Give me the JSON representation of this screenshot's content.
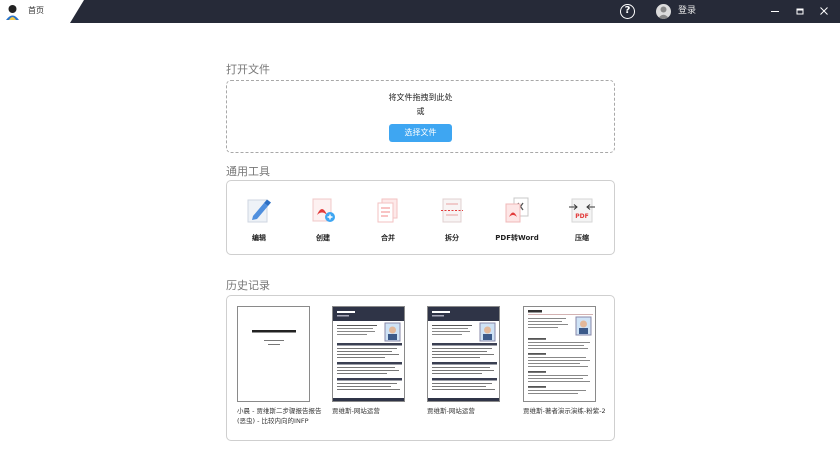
{
  "titlebar": {
    "tab_label": "首页",
    "login_label": "登录",
    "help_glyph": "?",
    "icons": [
      "app-logo-icon",
      "help-icon",
      "user-avatar-icon",
      "minimize-icon",
      "maximize-icon",
      "close-icon"
    ]
  },
  "open_file": {
    "title": "打开文件",
    "drop_hint": "将文件拖拽到此处",
    "or": "或",
    "choose_button": "选择文件"
  },
  "tools": {
    "title": "通用工具",
    "items": [
      {
        "label": "编辑",
        "icon": "edit-icon"
      },
      {
        "label": "创建",
        "icon": "create-pdf-icon"
      },
      {
        "label": "合并",
        "icon": "merge-icon"
      },
      {
        "label": "拆分",
        "icon": "split-icon"
      },
      {
        "label": "PDF转Word",
        "icon": "pdf-to-word-icon"
      },
      {
        "label": "压缩",
        "icon": "compress-icon"
      }
    ]
  },
  "history": {
    "title": "历史记录",
    "items": [
      {
        "name_line1": "小晨 - 贾维斯二步骤报告报告",
        "name_line2": "(恶虫) - 比较内向的INFP"
      },
      {
        "name_line1": "贾维斯-网站运营"
      },
      {
        "name_line1": "贾维斯-网站运营"
      },
      {
        "name_line1": "贾维斯-著者演示演练-粉紫-2"
      }
    ]
  },
  "colors": {
    "titlebar": "#262a38",
    "accent": "#3ea6f2",
    "pdf_red": "#e23b3b"
  }
}
